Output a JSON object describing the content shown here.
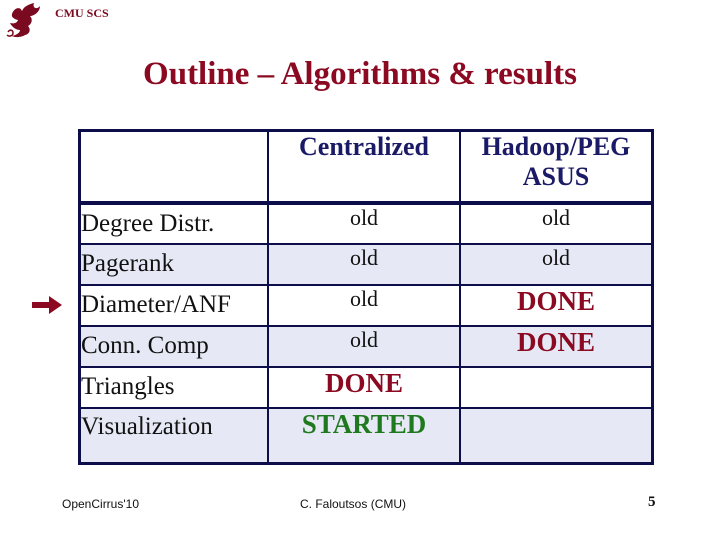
{
  "header": {
    "brand": "CMU SCS",
    "logo_icon": "griffin-logo-icon"
  },
  "slide": {
    "title": "Outline – Algorithms & results"
  },
  "table": {
    "columns": [
      "",
      "Centralized",
      "Hadoop/PEG\nASUS"
    ],
    "column_lines": [
      [
        "Centralized"
      ],
      [
        "Hadoop/PEG",
        "ASUS"
      ]
    ],
    "rows": [
      {
        "algorithm": "Degree Distr.",
        "centralized": "old",
        "hadoop": "old",
        "centralized_status": "old",
        "hadoop_status": "old"
      },
      {
        "algorithm": "Pagerank",
        "centralized": "old",
        "hadoop": "old",
        "centralized_status": "old",
        "hadoop_status": "old"
      },
      {
        "algorithm": "Diameter/ANF",
        "centralized": "old",
        "hadoop": "DONE",
        "centralized_status": "old",
        "hadoop_status": "done",
        "highlighted": true
      },
      {
        "algorithm": "Conn. Comp",
        "centralized": "old",
        "hadoop": "DONE",
        "centralized_status": "old",
        "hadoop_status": "done"
      },
      {
        "algorithm": "Triangles",
        "centralized": "DONE",
        "hadoop": "",
        "centralized_status": "done",
        "hadoop_status": "empty"
      },
      {
        "algorithm": "Visualization",
        "centralized": "STARTED",
        "hadoop": "",
        "centralized_status": "started",
        "hadoop_status": "empty"
      }
    ],
    "current_row_marker": "right-arrow-icon"
  },
  "colors": {
    "title": "#8b0a22",
    "header_text": "#1a1a66",
    "done": "#8b0a22",
    "started": "#1f7a1f",
    "border": "#0d0d4a",
    "row_shade": "#e6e9f5"
  },
  "footer": {
    "left": "OpenCirrus'10",
    "center": "C. Faloutsos (CMU)",
    "page_number": "5"
  }
}
